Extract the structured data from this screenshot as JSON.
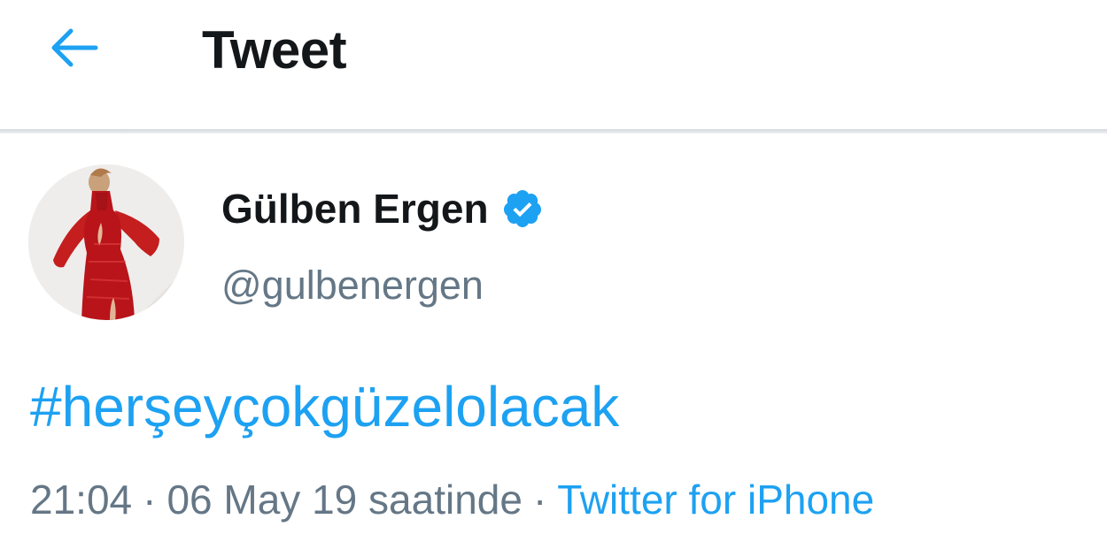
{
  "header": {
    "back_icon": "arrow-left-icon",
    "title": "Tweet",
    "accent": "#1da1f2"
  },
  "tweet": {
    "author": {
      "display_name": "Gülben Ergen",
      "verified_icon": "verified-badge-icon",
      "handle": "@gulbenergen"
    },
    "text": "#herşeyçokgüzelolacak",
    "time": "21:04",
    "separator": "·",
    "date": "06 May 19 saatinde",
    "source": "Twitter for iPhone"
  },
  "colors": {
    "link": "#1da1f2",
    "text_primary": "#14171a",
    "text_secondary": "#657786"
  }
}
